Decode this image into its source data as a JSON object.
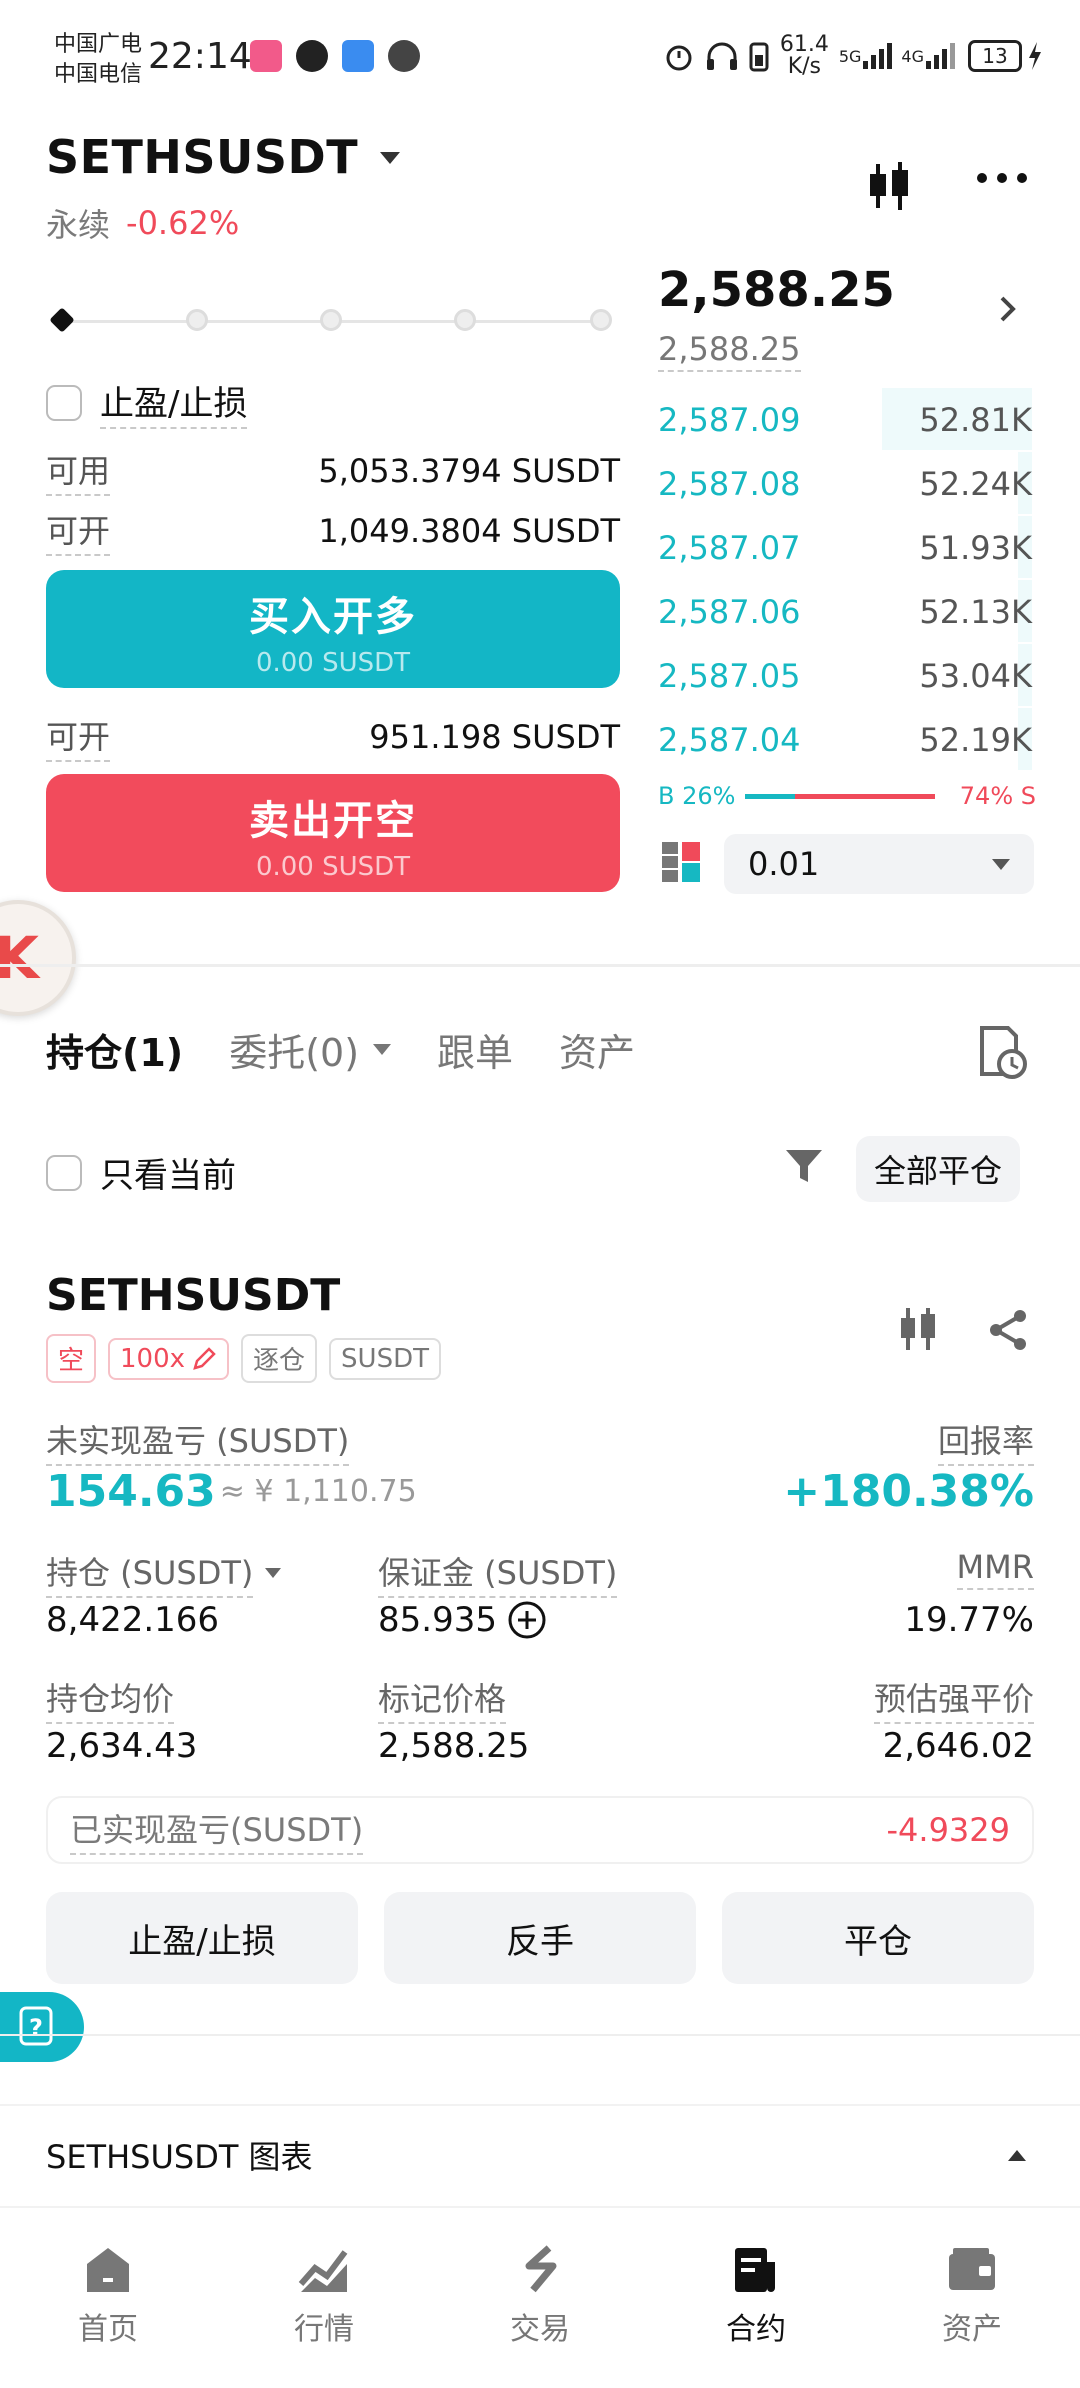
{
  "status_bar": {
    "carrier1": "中国广电",
    "carrier2": "中国电信",
    "time": "22:14",
    "net_speed": "61.4",
    "net_unit": "K/s",
    "sig1": "5G",
    "sig2": "4G",
    "battery": "13"
  },
  "header": {
    "symbol": "SETHSUSDT",
    "contract_type": "永续",
    "change": "-0.62%"
  },
  "trade_panel": {
    "tp_sl_label": "止盈/止损",
    "available_label": "可用",
    "available_value": "5,053.3794 SUSDT",
    "openable_label": "可开",
    "openable_long_value": "1,049.3804 SUSDT",
    "buy_label": "买入开多",
    "buy_amount": "0.00 SUSDT",
    "openable_short_value": "951.198 SUSDT",
    "sell_label": "卖出开空",
    "sell_amount": "0.00 SUSDT"
  },
  "order_book": {
    "last_price": "2,588.25",
    "mark_price": "2,588.25",
    "bids": [
      {
        "price": "2,587.09",
        "qty": "52.81K"
      },
      {
        "price": "2,587.08",
        "qty": "52.24K"
      },
      {
        "price": "2,587.07",
        "qty": "51.93K"
      },
      {
        "price": "2,587.06",
        "qty": "52.13K"
      },
      {
        "price": "2,587.05",
        "qty": "53.04K"
      },
      {
        "price": "2,587.04",
        "qty": "52.19K"
      }
    ],
    "buy_ratio": "B 26%",
    "sell_ratio": "74% S",
    "buy_ratio_fraction": 0.26,
    "depth": "0.01"
  },
  "tabs": {
    "positions": "持仓(1)",
    "orders": "委托(0)",
    "copy": "跟单",
    "assets": "资产"
  },
  "filter": {
    "current_only": "只看当前",
    "close_all": "全部平仓"
  },
  "position": {
    "symbol": "SETHSUSDT",
    "side_tag": "空",
    "leverage_tag": "100x",
    "margin_mode_tag": "逐仓",
    "coin_tag": "SUSDT",
    "unrealized_label": "未实现盈亏 (SUSDT)",
    "unrealized_value": "154.63",
    "unrealized_cny": "≈ ¥ 1,110.75",
    "roe_label": "回报率",
    "roe_value": "+180.38%",
    "size_label": "持仓 (SUSDT)",
    "size_value": "8,422.166",
    "margin_label": "保证金 (SUSDT)",
    "margin_value": "85.935",
    "mmr_label": "MMR",
    "mmr_value": "19.77%",
    "entry_label": "持仓均价",
    "entry_value": "2,634.43",
    "mark_label": "标记价格",
    "mark_value": "2,588.25",
    "liq_label": "预估强平价",
    "liq_value": "2,646.02",
    "realized_label": "已实现盈亏(SUSDT)",
    "realized_value": "-4.9329",
    "btn_tpsl": "止盈/止损",
    "btn_reverse": "反手",
    "btn_close": "平仓"
  },
  "chart_section": {
    "title": "SETHSUSDT 图表"
  },
  "bottom_nav": {
    "home": "首页",
    "market": "行情",
    "trade": "交易",
    "futures": "合约",
    "assets": "资产"
  },
  "colors": {
    "teal": "#16b8c2",
    "red": "#f04a5a",
    "orange": "#f2a928"
  }
}
